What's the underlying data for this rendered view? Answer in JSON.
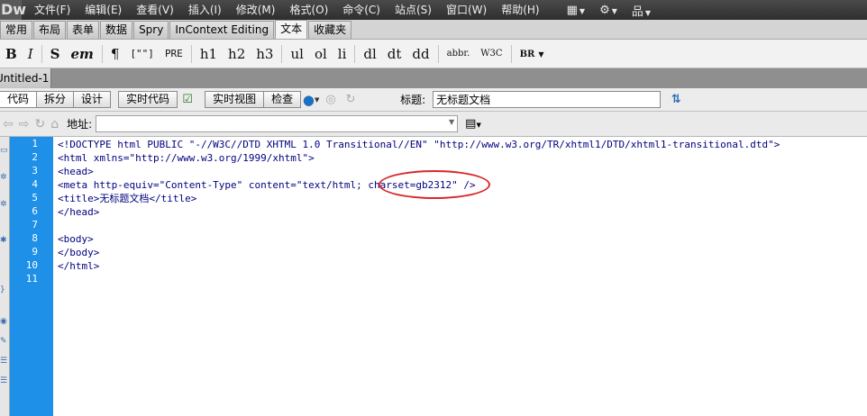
{
  "menubar": {
    "logo": "Dw",
    "menus": [
      "文件(F)",
      "编辑(E)",
      "查看(V)",
      "插入(I)",
      "修改(M)",
      "格式(O)",
      "命令(C)",
      "站点(S)",
      "窗口(W)",
      "帮助(H)"
    ],
    "icons": [
      "layout-icon",
      "gear-icon",
      "site-icon"
    ]
  },
  "insert_tabs": [
    "常用",
    "布局",
    "表单",
    "数据",
    "Spry",
    "InContext Editing",
    "文本",
    "收藏夹"
  ],
  "active_insert_tab": "文本",
  "format_buttons": [
    "B",
    "I",
    "S",
    "em",
    "¶",
    "[\"\"]",
    "PRE",
    "h1",
    "h2",
    "h3",
    "ul",
    "ol",
    "li",
    "dl",
    "dt",
    "dd",
    "abbr.",
    "W3C",
    "BR"
  ],
  "doc_tab": "Untitled-1",
  "doc_toolbar": {
    "code": "代码",
    "split": "拆分",
    "design": "设计",
    "live_code": "实时代码",
    "live_view": "实时视图",
    "inspect": "检查",
    "title_label": "标题:",
    "title_value": "无标题文档"
  },
  "address": {
    "label": "地址:",
    "value": ""
  },
  "code_lines": [
    "<!DOCTYPE html PUBLIC \"-//W3C//DTD XHTML 1.0 Transitional//EN\" \"http://www.w3.org/TR/xhtml1/DTD/xhtml1-transitional.dtd\">",
    "<html xmlns=\"http://www.w3.org/1999/xhtml\">",
    "<head>",
    "<meta http-equiv=\"Content-Type\" content=\"text/html; charset=gb2312\" />",
    "<title>无标题文档</title>",
    "</head>",
    "",
    "<body>",
    "</body>",
    "</html>",
    ""
  ],
  "line_numbers": [
    "1",
    "2",
    "3",
    "4",
    "5",
    "6",
    "7",
    "8",
    "9",
    "10",
    "11"
  ],
  "colors": {
    "gutter": "#1e90e8",
    "code_text": "#000080",
    "annotation": "#d9282a"
  }
}
